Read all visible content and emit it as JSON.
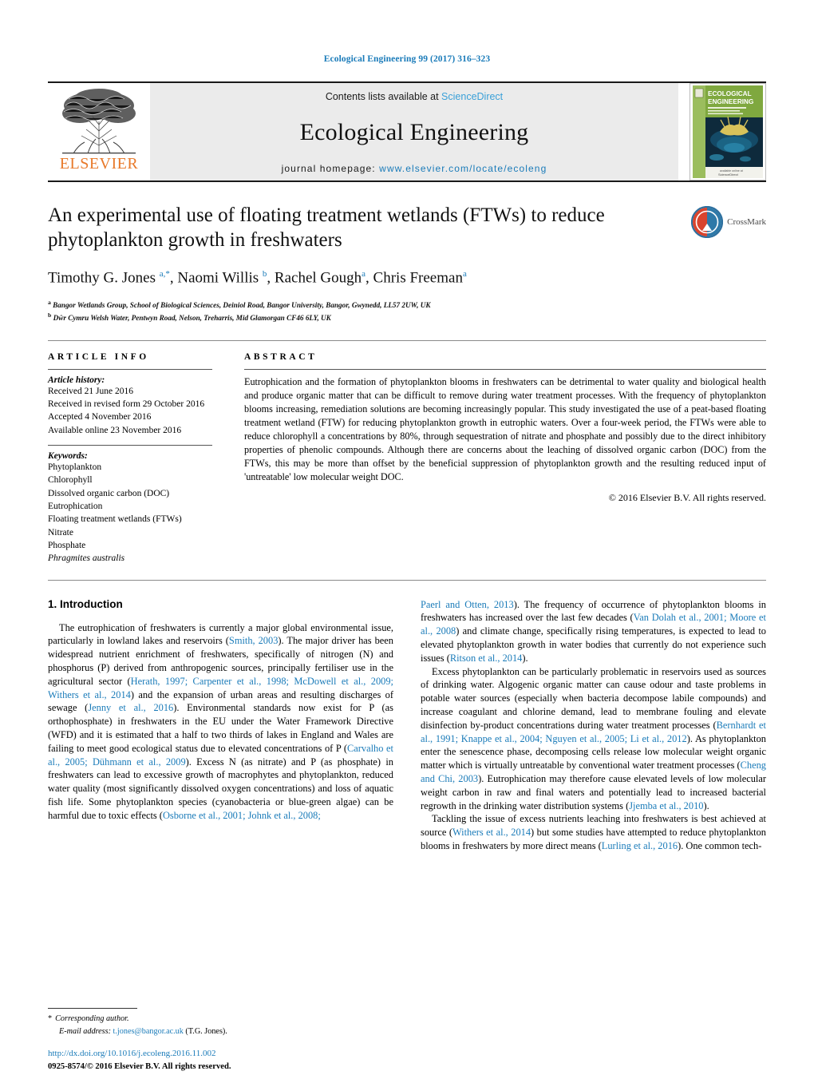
{
  "running_head": "Ecological Engineering 99 (2017) 316–323",
  "journal_header": {
    "contents_prefix": "Contents lists available at ",
    "sciencedirect": "ScienceDirect",
    "journal_name": "Ecological Engineering",
    "homepage_prefix": "journal homepage: ",
    "homepage_url": "www.elsevier.com/locate/ecoleng",
    "publisher": "ELSEVIER",
    "cover_title_line1": "ECOLOGICAL",
    "cover_title_line2": "ENGINEERING"
  },
  "article": {
    "title": "An experimental use of floating treatment wetlands (FTWs) to reduce phytoplankton growth in freshwaters",
    "authors_html": "Timothy G. Jones <sup>a,*</sup>, Naomi Willis <sup>b</sup>, Rachel Gough<sup>a</sup>, Chris Freeman<sup>a</sup>",
    "affiliation_a": "Bangor Wetlands Group, School of Biological Sciences, Deiniol Road, Bangor University, Bangor, Gwynedd, LL57 2UW, UK",
    "affiliation_b": "Dŵr Cymru Welsh Water, Pentwyn Road, Nelson, Treharris, Mid Glamorgan CF46 6LY, UK",
    "crossmark_label": "CrossMark"
  },
  "article_info": {
    "heading": "ARTICLE INFO",
    "history_title": "Article history:",
    "history": [
      "Received 21 June 2016",
      "Received in revised form 29 October 2016",
      "Accepted 4 November 2016",
      "Available online 23 November 2016"
    ],
    "keywords_title": "Keywords:",
    "keywords": [
      "Phytoplankton",
      "Chlorophyll",
      "Dissolved organic carbon (DOC)",
      "Eutrophication",
      "Floating treatment wetlands (FTWs)",
      "Nitrate",
      "Phosphate"
    ],
    "keyword_italic": "Phragmites australis"
  },
  "abstract": {
    "heading": "ABSTRACT",
    "text": "Eutrophication and the formation of phytoplankton blooms in freshwaters can be detrimental to water quality and biological health and produce organic matter that can be difficult to remove during water treatment processes. With the frequency of phytoplankton blooms increasing, remediation solutions are becoming increasingly popular. This study investigated the use of a peat-based floating treatment wetland (FTW) for reducing phytoplankton growth in eutrophic waters. Over a four-week period, the FTWs were able to reduce chlorophyll a concentrations by 80%, through sequestration of nitrate and phosphate and possibly due to the direct inhibitory properties of phenolic compounds. Although there are concerns about the leaching of dissolved organic carbon (DOC) from the FTWs, this may be more than offset by the beneficial suppression of phytoplankton growth and the resulting reduced input of 'untreatable' low molecular weight DOC.",
    "copyright": "© 2016 Elsevier B.V. All rights reserved."
  },
  "body": {
    "section_number_title": "1.  Introduction",
    "left_paragraph_1_html": "The eutrophication of freshwaters is currently a major global environmental issue, particularly in lowland lakes and reservoirs (<span class=\"ref\">Smith, 2003</span>). The major driver has been widespread nutrient enrichment of freshwaters, specifically of nitrogen (N) and phosphorus (P) derived from anthropogenic sources, principally fertiliser use in the agricultural sector (<span class=\"ref\">Herath, 1997; Carpenter et al., 1998; McDowell et al., 2009; Withers et al., 2014</span>) and the expansion of urban areas and resulting discharges of sewage (<span class=\"ref\">Jenny et al., 2016</span>). Environmental standards now exist for P (as orthophosphate) in freshwaters in the EU under the Water Framework Directive (WFD) and it is estimated that a half to two thirds of lakes in England and Wales are failing to meet good ecological status due to elevated concentrations of P (<span class=\"ref\">Carvalho et al., 2005; Dühmann et al., 2009</span>). Excess N (as nitrate) and P (as phosphate) in freshwaters can lead to excessive growth of macrophytes and phytoplankton, reduced water quality (most significantly dissolved oxygen concentrations) and loss of aquatic fish life. Some phytoplankton species (cyanobacteria or blue-green algae) can be harmful due to toxic effects (<span class=\"ref\">Osborne et al., 2001; Johnk et al., 2008;</span>",
    "right_paragraph_1_html": "<span class=\"ref\">Paerl and Otten, 2013</span>). The frequency of occurrence of phytoplankton blooms in freshwaters has increased over the last few decades (<span class=\"ref\">Van Dolah et al., 2001; Moore et al., 2008</span>) and climate change, specifically rising temperatures, is expected to lead to elevated phytoplankton growth in water bodies that currently do not experience such issues (<span class=\"ref\">Ritson et al., 2014</span>).",
    "right_paragraph_2_html": "Excess phytoplankton can be particularly problematic in reservoirs used as sources of drinking water. Algogenic organic matter can cause odour and taste problems in potable water sources (especially when bacteria decompose labile compounds) and increase coagulant and chlorine demand, lead to membrane fouling and elevate disinfection by-product concentrations during water treatment processes (<span class=\"ref\">Bernhardt et al., 1991; Knappe et al., 2004; Nguyen et al., 2005; Li et al., 2012</span>). As phytoplankton enter the senescence phase, decomposing cells release low molecular weight organic matter which is virtually untreatable by conventional water treatment processes (<span class=\"ref\">Cheng and Chi, 2003</span>). Eutrophication may therefore cause elevated levels of low molecular weight carbon in raw and final waters and potentially lead to increased bacterial regrowth in the drinking water distribution systems (<span class=\"ref\">Jjemba et al., 2010</span>).",
    "right_paragraph_3_html": "Tackling the issue of excess nutrients leaching into freshwaters is best achieved at source (<span class=\"ref\">Withers et al., 2014</span>) but some studies have attempted to reduce phytoplankton blooms in freshwaters by more direct means (<span class=\"ref\">Lurling et al., 2016</span>). One common tech-"
  },
  "footnote": {
    "corresponding": "Corresponding author.",
    "email_label": "E-mail address:",
    "email": "t.jones@bangor.ac.uk",
    "email_suffix": "(T.G. Jones).",
    "doi": "http://dx.doi.org/10.1016/j.ecoleng.2016.11.002",
    "issn_line": "0925-8574/© 2016 Elsevier B.V. All rights reserved."
  },
  "colors": {
    "link_blue": "#1a7bb9",
    "sciencedirect_blue": "#3aa0d8",
    "elsevier_orange": "#e8792a",
    "band_gray": "#ebebeb"
  }
}
